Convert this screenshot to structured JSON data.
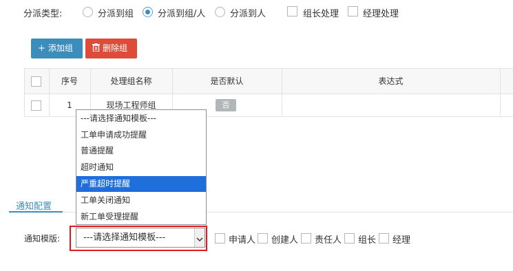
{
  "assign": {
    "type_label": "分派类型:",
    "options": [
      {
        "label": "分派到组",
        "selected": false
      },
      {
        "label": "分派到组/人",
        "selected": true
      },
      {
        "label": "分派到人",
        "selected": false
      }
    ],
    "checks": [
      {
        "label": "组长处理",
        "checked": false
      },
      {
        "label": "经理处理",
        "checked": false
      }
    ]
  },
  "toolbar": {
    "add_label": "添加组",
    "delete_label": "删除组"
  },
  "table": {
    "headers": [
      "序号",
      "处理组名称",
      "是否默认",
      "表达式"
    ],
    "rows": [
      {
        "index": "1",
        "name": "现场工程师组",
        "default": "否",
        "expression": ""
      }
    ]
  },
  "dropdown": {
    "items": [
      "---请选择通知模板---",
      "工单申请成功提醒",
      "普通提醒",
      "超时通知",
      "严重超时提醒",
      "工单关闭通知",
      "新工单受理提醒"
    ],
    "highlighted_index": 4
  },
  "tabs": {
    "active": "通知配置"
  },
  "notify": {
    "template_label": "通知模版:",
    "template_value": "---请选择通知模板---",
    "recipients": [
      "申请人",
      "创建人",
      "责任人",
      "组长",
      "经理"
    ]
  },
  "colors": {
    "primary": "#3c8dbc",
    "danger": "#dd4b39",
    "highlight": "#1e6fd9",
    "outline": "#e0181e"
  }
}
